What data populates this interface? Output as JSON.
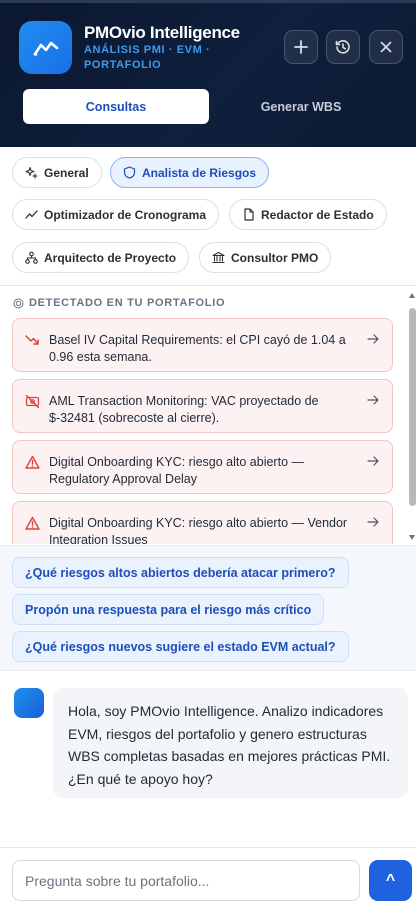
{
  "header": {
    "title": "PMOvio Intelligence",
    "subtitle": "ANÁLISIS PMI · EVM · PORTAFOLIO",
    "buttons": [
      "plus-icon",
      "history-icon",
      "close-icon"
    ]
  },
  "tabs": [
    {
      "label": "Consultas",
      "active": true
    },
    {
      "label": "Generar WBS",
      "active": false
    }
  ],
  "agents": [
    {
      "label": "General",
      "icon": "sparkles-icon",
      "selected": false
    },
    {
      "label": "Analista de Riesgos",
      "icon": "shield-icon",
      "selected": true
    },
    {
      "label": "Optimizador de Cronograma",
      "icon": "trend-icon",
      "selected": false
    },
    {
      "label": "Redactor de Estado",
      "icon": "document-icon",
      "selected": false
    },
    {
      "label": "Arquitecto de Proyecto",
      "icon": "hierarchy-icon",
      "selected": false
    },
    {
      "label": "Consultor PMO",
      "icon": "institution-icon",
      "selected": false
    }
  ],
  "portfolio": {
    "label": "DETECTADO EN TU PORTAFOLIO",
    "alerts": [
      {
        "icon": "trend-down-icon",
        "text": "Basel IV Capital Requirements: el CPI cayó de 1.04 a 0.96 esta semana."
      },
      {
        "icon": "money-off-icon",
        "text": "AML Transaction Monitoring: VAC proyectado de $-32481 (sobrecoste al cierre)."
      },
      {
        "icon": "warning-icon",
        "text": "Digital Onboarding KYC: riesgo alto abierto — Regulatory Approval Delay"
      },
      {
        "icon": "warning-icon",
        "text": "Digital Onboarding KYC: riesgo alto abierto — Vendor Integration Issues"
      }
    ]
  },
  "suggestions": [
    "¿Qué riesgos altos abiertos debería atacar primero?",
    "Propón una respuesta para el riesgo más crítico",
    "¿Qué riesgos nuevos sugiere el estado EVM actual?"
  ],
  "chat": {
    "message": "Hola, soy PMOvio Intelligence. Analizo indicadores EVM, riesgos del portafolio y genero estructuras WBS completas basadas en mejores prácticas PMI. ¿En qué te apoyo hoy?"
  },
  "composer": {
    "placeholder": "Pregunta sobre tu portafolio...",
    "send_label": "^"
  },
  "colors": {
    "accent": "#1f62e0",
    "header_bg": "#0f1f3c",
    "alert_bg": "#fdf2f2",
    "alert_icon": "#e0413b"
  }
}
